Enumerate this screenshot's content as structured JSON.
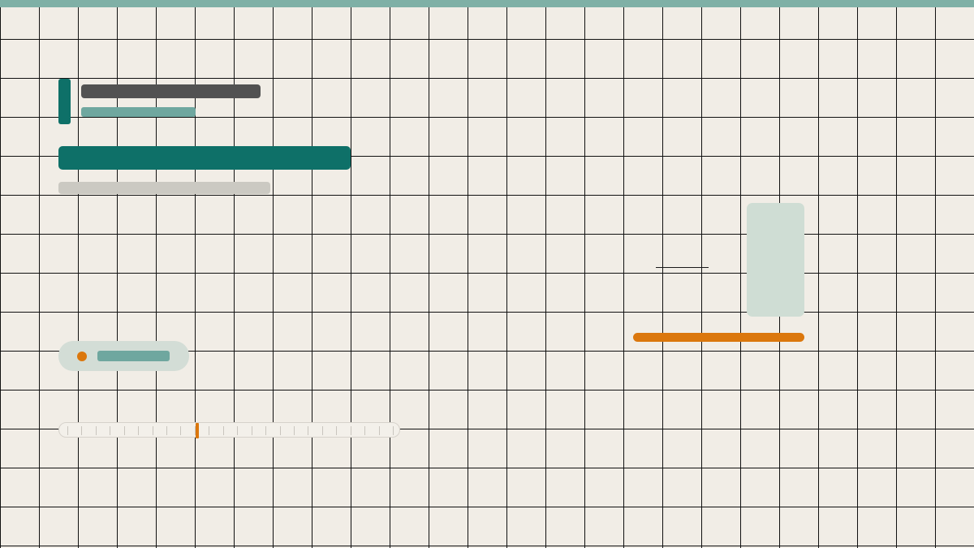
{
  "colors": {
    "background": "#f1ede6",
    "grid_line": "#111111",
    "top_strip": "#7fb0a6",
    "primary": "#0e7068",
    "primary_light": "#6fa79f",
    "text_placeholder_dark": "#525252",
    "text_placeholder_light": "#cbc9c2",
    "card_tint": "#cfddd4",
    "accent_orange": "#db770d"
  },
  "slider": {
    "tick_count": 24,
    "value_fraction": 0.4
  }
}
